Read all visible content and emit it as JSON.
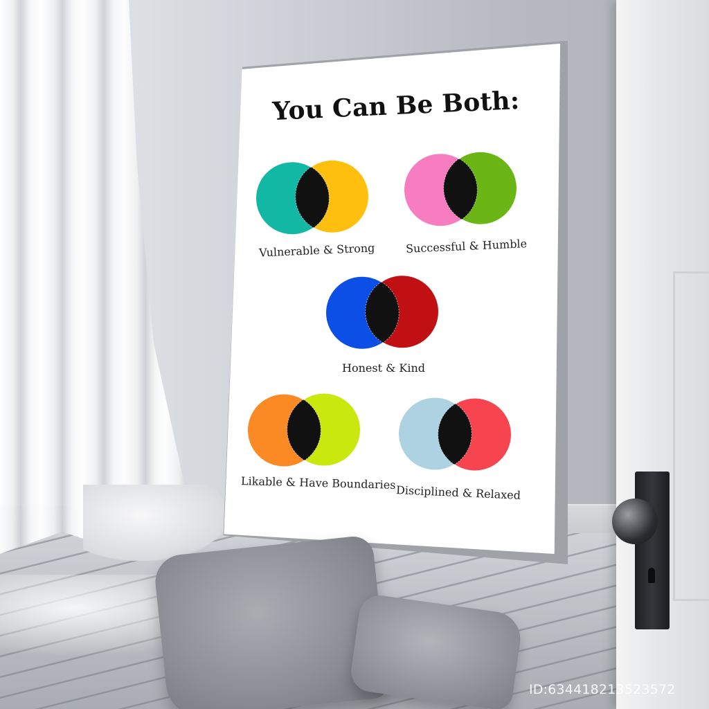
{
  "poster": {
    "title": "You Can Be Both:",
    "pairs": [
      {
        "label": "Vulnerable & Strong",
        "left_color": "#12b8a4",
        "right_color": "#ffbf0f"
      },
      {
        "label": "Successful & Humble",
        "left_color": "#f77cc0",
        "right_color": "#6bb515"
      },
      {
        "label": "Honest & Kind",
        "left_color": "#0b4fe6",
        "right_color": "#c01014"
      },
      {
        "label": "Likable & Have Boundaries",
        "left_color": "#fb8a24",
        "right_color": "#c9e80e"
      },
      {
        "label": "Disciplined & Relaxed",
        "left_color": "#add3e3",
        "right_color": "#f6454e"
      }
    ],
    "overlap_color": "#111111"
  },
  "watermark": "ID:6344182135235​72"
}
